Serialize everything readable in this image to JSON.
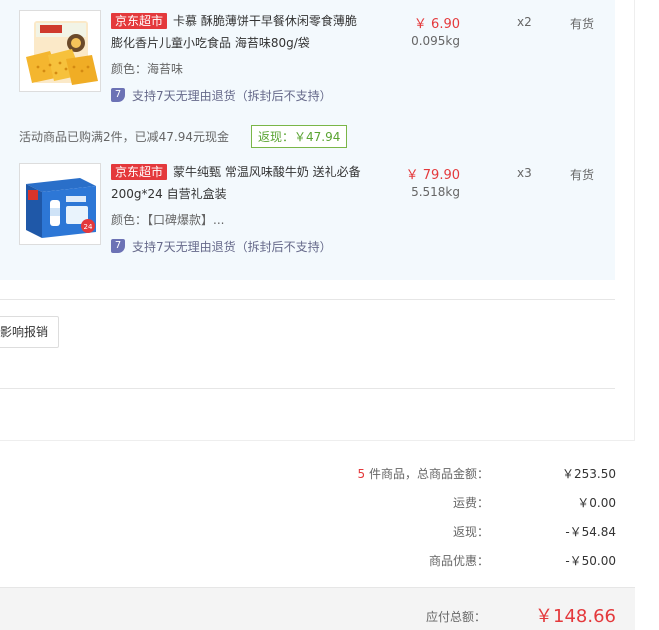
{
  "products": [
    {
      "tag": "京东超市",
      "title": "卡慕 酥脆薄饼干早餐休闲零食薄脆膨化香片儿童小吃食品 海苔味80g/袋",
      "attr": "颜色：海苔味",
      "return_policy": "支持7天无理由退货（拆封后不支持）",
      "price": "￥ 6.90",
      "weight": "0.095kg",
      "qty": "x2",
      "stock": "有货"
    },
    {
      "tag": "京东超市",
      "title": "蒙牛纯甄 常温风味酸牛奶 送礼必备 200g*24 自营礼盒装",
      "attr": "颜色：【口碑爆款】...",
      "return_policy": "支持7天无理由退货（拆封后不支持）",
      "price": "￥ 79.90",
      "weight": "5.518kg",
      "qty": "x3",
      "stock": "有货"
    }
  ],
  "promo": {
    "text": "活动商品已购满2件，已减47.94元现金",
    "rebate": "返现：￥47.94"
  },
  "reimburse_button": "影响报销",
  "summary": {
    "count": "5",
    "count_label": " 件商品，总商品金额：",
    "total_goods": "￥253.50",
    "shipping_label": "运费：",
    "shipping": "￥0.00",
    "rebate_label": "返现：",
    "rebate": "-￥54.84",
    "discount_label": "商品优惠：",
    "discount": "-￥50.00"
  },
  "payable": {
    "label": "应付总额：",
    "amount": "￥148.66"
  },
  "colors": {
    "accent_red": "#e4393c",
    "panel_bg": "#f3f9fd",
    "rebate_green": "#5aa432"
  }
}
